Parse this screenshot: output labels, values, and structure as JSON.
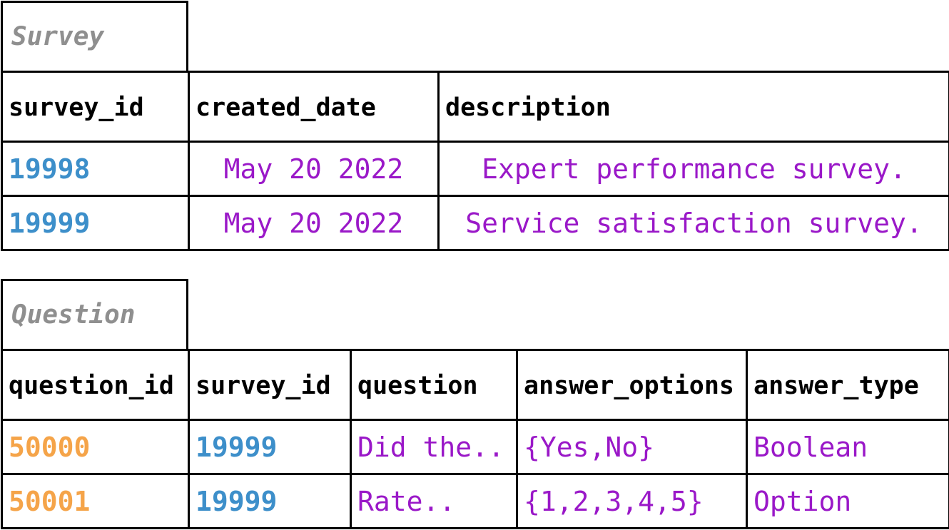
{
  "survey": {
    "title": "Survey",
    "columns": [
      "survey_id",
      "created_date",
      "description"
    ],
    "rows": [
      [
        "19998",
        "May 20 2022",
        "Expert performance survey."
      ],
      [
        "19999",
        "May 20 2022",
        "Service satisfaction survey."
      ]
    ]
  },
  "question": {
    "title": "Question",
    "columns": [
      "question_id",
      "survey_id",
      "question",
      "answer_options",
      "answer_type"
    ],
    "rows": [
      [
        "50000",
        "19999",
        "Did the..",
        "{Yes,No}",
        "Boolean"
      ],
      [
        "50001",
        "19999",
        "Rate..",
        "{1,2,3,4,5}",
        "Option"
      ]
    ]
  },
  "colors": {
    "primary_key": "#3d8fca",
    "foreign_key": "#f5a449",
    "value": "#9a18c8",
    "title": "#8f8f8f"
  }
}
